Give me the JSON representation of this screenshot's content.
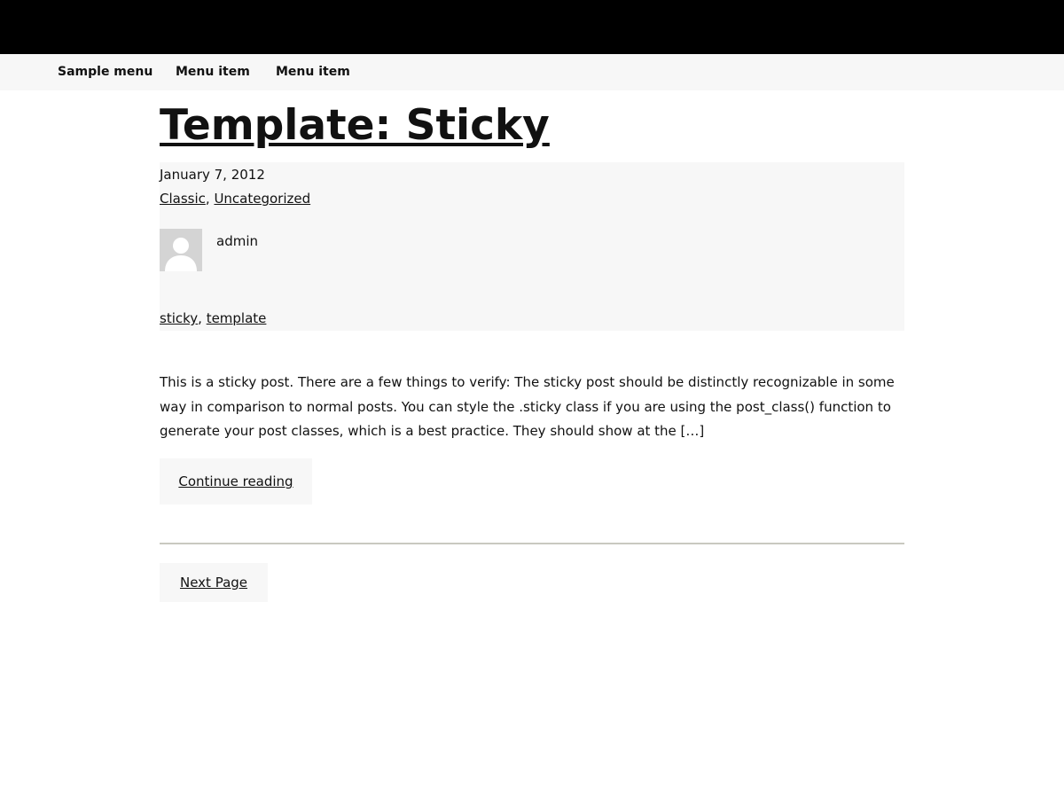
{
  "nav": {
    "items": [
      {
        "label": "Sample menu"
      },
      {
        "label": "Menu item"
      },
      {
        "label": "Menu item"
      }
    ]
  },
  "post": {
    "title": "Template: Sticky",
    "date": "January 7, 2012",
    "categories": [
      "Classic",
      "Uncategorized"
    ],
    "author": "admin",
    "tags": [
      "sticky",
      "template"
    ],
    "excerpt": "This is a sticky post. There are a few things to verify: The sticky post should be distinctly recognizable in some way in comparison to normal posts. You can style the .sticky class if you are using the post_class() function to generate your post classes, which is a best practice. They should show at the […]",
    "continue_label": "Continue reading"
  },
  "pagination": {
    "next_label": "Next Page"
  },
  "colors": {
    "header_bg": "#000000",
    "nav_bg": "#f7f7f7",
    "meta_bg": "#f7f7f7",
    "divider": "#c9c9c0"
  },
  "icons": {
    "avatar": "user-avatar-placeholder"
  }
}
